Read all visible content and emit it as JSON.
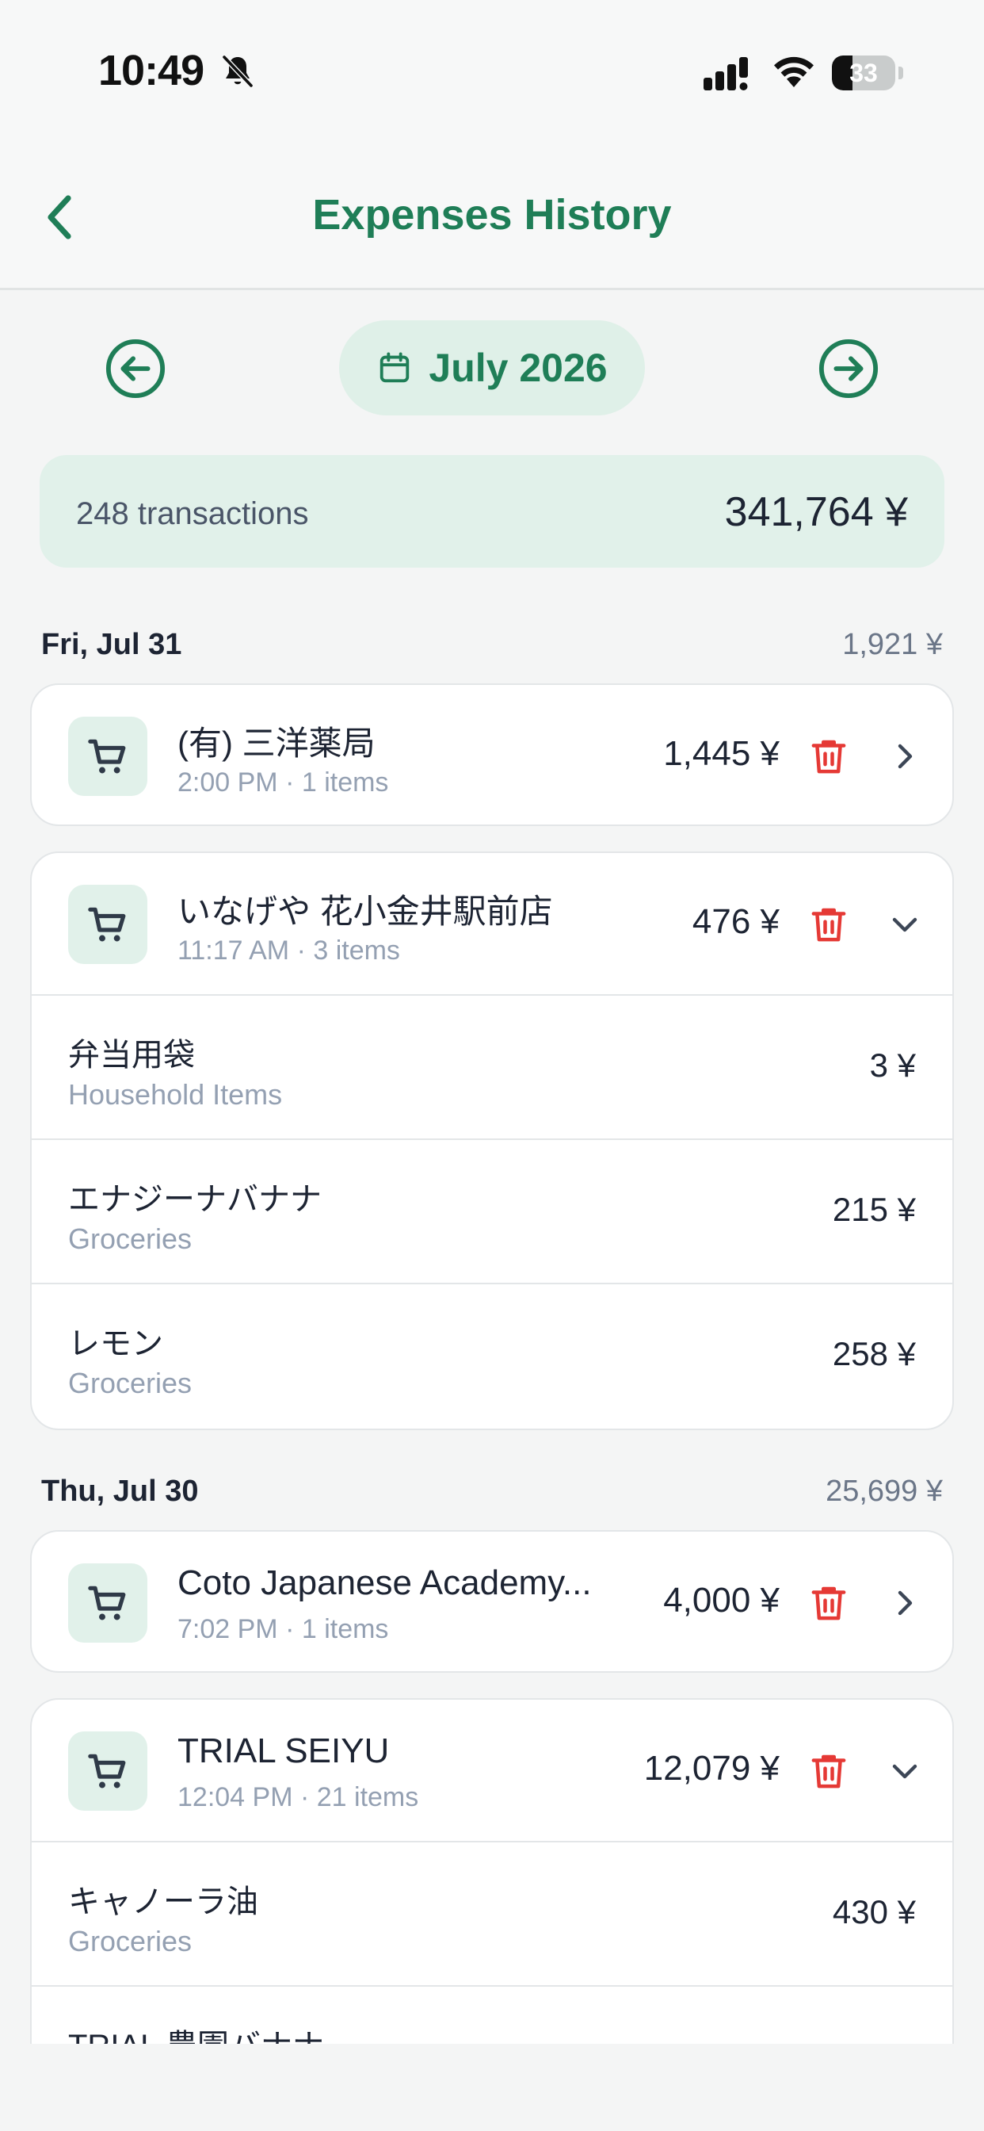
{
  "status_bar": {
    "time": "10:49",
    "battery": "33",
    "battery_level_percent": 33
  },
  "nav": {
    "title": "Expenses History"
  },
  "month_selector": {
    "label": "July 2026"
  },
  "summary": {
    "transactions": "248 transactions",
    "total": "341,764 ¥"
  },
  "days": [
    {
      "label": "Fri, Jul 31",
      "total": "1,921 ¥",
      "transactions": [
        {
          "name": "(有) 三洋薬局",
          "meta": "2:00 PM · 1 items",
          "amount": "1,445 ¥",
          "expanded": false
        },
        {
          "name": "いなげや 花小金井駅前店",
          "meta": "11:17 AM · 3 items",
          "amount": "476 ¥",
          "expanded": true,
          "items": [
            {
              "name": "弁当用袋",
              "category": "Household Items",
              "amount": "3 ¥"
            },
            {
              "name": "エナジーナバナナ",
              "category": "Groceries",
              "amount": "215 ¥"
            },
            {
              "name": "レモン",
              "category": "Groceries",
              "amount": "258 ¥"
            }
          ]
        }
      ]
    },
    {
      "label": "Thu, Jul 30",
      "total": "25,699 ¥",
      "transactions": [
        {
          "name": "Coto Japanese Academy...",
          "meta": "7:02 PM · 1 items",
          "amount": "4,000 ¥",
          "expanded": false
        },
        {
          "name": "TRIAL SEIYU",
          "meta": "12:04 PM · 21 items",
          "amount": "12,079 ¥",
          "expanded": true,
          "items": [
            {
              "name": "キャノーラ油",
              "category": "Groceries",
              "amount": "430 ¥"
            },
            {
              "name": "TRIAL 農園バナナ",
              "category": "",
              "amount": ""
            }
          ]
        }
      ]
    }
  ],
  "icons": {
    "cart": "shopping-cart-icon",
    "trash": "trash-icon",
    "chevron_right": "chevron-right-icon",
    "chevron_down": "chevron-down-icon",
    "calendar": "calendar-icon"
  },
  "colors": {
    "brand_green": "#1f7e57",
    "light_green": "#e1f1ea",
    "delete_red": "#e53935",
    "muted_text": "#94a0b2"
  }
}
